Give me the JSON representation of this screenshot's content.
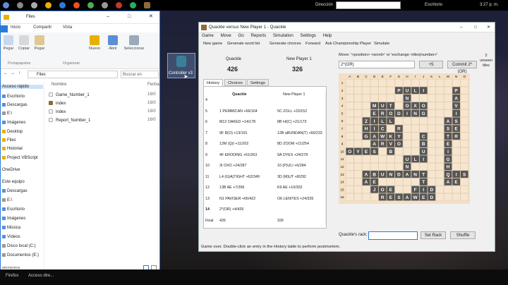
{
  "topbar": {
    "address_label": "Dirección",
    "desktop_label": "Escritorio",
    "clock": "3:27 p. m."
  },
  "explorer": {
    "title": "Files",
    "ribbon_tabs": [
      "Inicio",
      "Compartir",
      "Vista"
    ],
    "ribbon_buttons": [
      "Pegar",
      "Copiar",
      "Pegar",
      "Nuevo",
      "Abrir",
      "Seleccionar"
    ],
    "ribbon_groups": [
      "Portapapeles",
      "Organizar"
    ],
    "address": "Files",
    "search_placeholder": "Buscar en",
    "nav_items": [
      "Acceso rápido",
      "Escritorio",
      "Descargas",
      "E:\\",
      "Imágenes",
      "Desktop",
      "Files",
      "Historial",
      "Project VBScript",
      "OneDrive",
      "Este equipo",
      "Descargas",
      "E:\\",
      "Escritorio",
      "Imágenes",
      "Música",
      "Vídeos",
      "Disco local (C:)",
      "Documentos (E:)"
    ],
    "col_name": "Nombre",
    "col_date": "Fecha",
    "files": [
      {
        "name": "Game_Number_1",
        "date": "16/0"
      },
      {
        "name": "index",
        "date": "16/0"
      },
      {
        "name": "index",
        "date": "16/0"
      },
      {
        "name": "Report_Number_1",
        "date": "16/0"
      }
    ],
    "status": "elementos"
  },
  "desktop_icon": {
    "label": "Controller v3"
  },
  "taskbar": {
    "items": [
      "Firefox",
      "Acceso dire..."
    ]
  },
  "quackle": {
    "title": "Quackle versus New Player 1 - Quackle",
    "menu": [
      "Game",
      "Move",
      "Go",
      "Reports",
      "Simulation",
      "Settings",
      "Help"
    ],
    "toolbar": [
      "New game",
      "Generate word list",
      "Generate choices",
      "Forward",
      "Ask Championship Player",
      "Simulate"
    ],
    "players": [
      {
        "name": "Quackle",
        "score": "426"
      },
      {
        "name": "New Player 1",
        "score": "326"
      }
    ],
    "tabs": [
      "History",
      "Choices",
      "Settings"
    ],
    "history": {
      "head_p1": "Quackle",
      "head_p2": "New Player 1",
      "rows": [
        {
          "turn": "4",
          "p1": "",
          "p2": ""
        },
        {
          "turn": "5",
          "p1": "1 PEMMICAN +66/164",
          "p2": "5C ZOLL +23/152"
        },
        {
          "turn": "6",
          "p1": "M12 OAKED +14/178",
          "p2": "8B HI(C) +21/173"
        },
        {
          "turn": "7",
          "p1": "9F B(O) +13/191",
          "p2": "12B aBUNDAN(T) +60/233"
        },
        {
          "turn": "8",
          "p1": "12M (Q)I +11/202",
          "p2": "8D ZOOM +21/254"
        },
        {
          "turn": "9",
          "p1": "4F ERODING +61/263",
          "p2": "9A OYES +24/278"
        },
        {
          "turn": "10",
          "p1": "3I OXO +24/287",
          "p2": "10 (P)ULI +6/284"
        },
        {
          "turn": "11",
          "p1": "L4 (G)A)TIGHT +62/349",
          "p2": "3D (M)UT +8/292"
        },
        {
          "turn": "12",
          "p1": "13B AE +7/356",
          "p2": "K9 AE +10/302"
        },
        {
          "turn": "13",
          "p1": "N1 PAVISER +66/422",
          "p2": "O6 LENITES +24/326"
        },
        {
          "turn": "14",
          "p1": "2*(OR) +4/426",
          "p2": ""
        },
        {
          "turn": "Final",
          "p1": "426",
          "p2": "326"
        }
      ]
    },
    "move_label": "Move: '<position> <word>' or 'exchange <tiles|number>'",
    "move_value": "2*(OR)",
    "plus_label": "+5",
    "commit_label": "Commit 2*(OR)",
    "unseen_label": "2 unseen tiles",
    "unseen_count": "2",
    "col_letters": [
      "A",
      "B",
      "C",
      "D",
      "E",
      "F",
      "G",
      "H",
      "I",
      "J",
      "K",
      "L",
      "M",
      "N",
      "O"
    ],
    "board": [
      "...............",
      "......PULI...P.",
      ".......N.....A.",
      "...MUT.OXO...V.",
      "...ERODING...I.",
      "..ZILL......AS.",
      "..HIC.R.....SE.",
      "..GAWKY..C..TR.",
      "...ARVO..B..E..",
      "OYES.B...U..I..",
      ".......ULI..G..",
      ".......N....H..",
      "..ABUNDANT..QIS",
      "..AE.....T..AE.",
      "...JOE..FID....",
      "....RESAWED...."
    ],
    "rack_label": "Quackle's rack:",
    "set_rack": "Set Rack",
    "shuffle": "Shuffle",
    "status": "Game over. Double-click an entry in the History table to perform postmortem."
  }
}
